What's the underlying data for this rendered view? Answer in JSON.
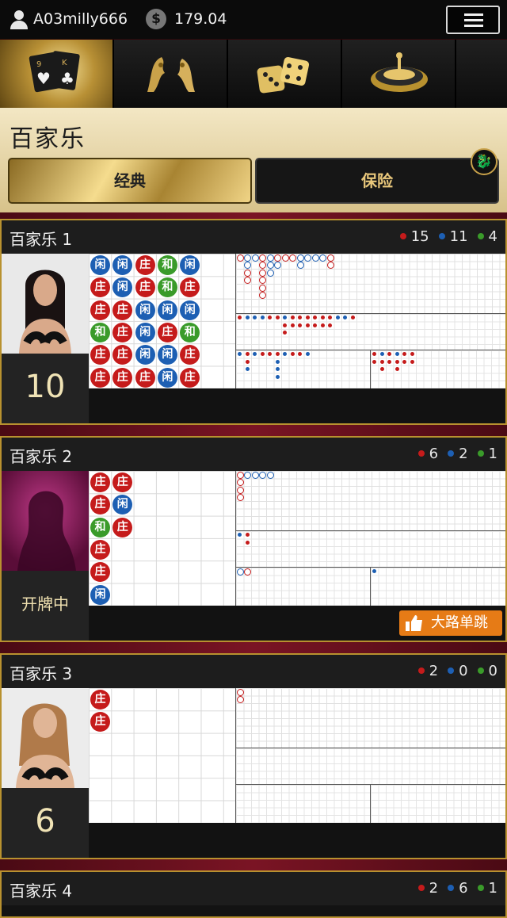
{
  "topbar": {
    "username": "A03milly666",
    "coin_symbol": "$",
    "balance": "179.04",
    "menu_icon": "hamburger-icon"
  },
  "categories": [
    {
      "id": "cards",
      "icon": "playing-cards-icon",
      "active": true,
      "card_labels": [
        "9",
        "K"
      ]
    },
    {
      "id": "dragon-tiger",
      "icon": "dragon-tiger-icon"
    },
    {
      "id": "dice",
      "icon": "dice-icon"
    },
    {
      "id": "roulette",
      "icon": "roulette-icon"
    }
  ],
  "section": {
    "title": "百家乐",
    "tabs": [
      {
        "label": "经典",
        "active": true
      },
      {
        "label": "保险",
        "active": false
      }
    ],
    "badge_icon": "dragon-badge-icon"
  },
  "tables": [
    {
      "name": "百家乐 1",
      "red": "15",
      "blue": "11",
      "green": "4",
      "status": "10",
      "status_type": "count",
      "bead": [
        [
          "闲",
          "闲",
          "庄",
          "和",
          "闲"
        ],
        [
          "庄",
          "闲",
          "庄",
          "和",
          "庄"
        ],
        [
          "庄",
          "庄",
          "闲",
          "闲",
          "闲"
        ],
        [
          "和",
          "庄",
          "闲",
          "庄",
          "和"
        ],
        [
          "庄",
          "庄",
          "闲",
          "闲",
          "庄"
        ],
        [
          "庄",
          "庄",
          "庄",
          "闲",
          "庄"
        ]
      ]
    },
    {
      "name": "百家乐 2",
      "red": "6",
      "blue": "2",
      "green": "1",
      "status": "开牌中",
      "status_type": "text",
      "badge": "大路单跳",
      "bead": [
        [
          "庄",
          "庄"
        ],
        [
          "庄",
          "闲"
        ],
        [
          "和",
          "庄"
        ],
        [
          "庄"
        ],
        [
          "庄"
        ],
        [
          "闲"
        ]
      ]
    },
    {
      "name": "百家乐 3",
      "red": "2",
      "blue": "0",
      "green": "0",
      "status": "6",
      "status_type": "count",
      "bead": [
        [
          "庄"
        ],
        [
          "庄"
        ]
      ]
    },
    {
      "name": "百家乐 4",
      "red": "2",
      "blue": "6",
      "green": "1"
    }
  ],
  "colors": {
    "banker": "#c51b1b",
    "player": "#1d5fb3",
    "tie": "#3a9b2a",
    "gold": "#b8912f",
    "badge": "#e67b16"
  }
}
